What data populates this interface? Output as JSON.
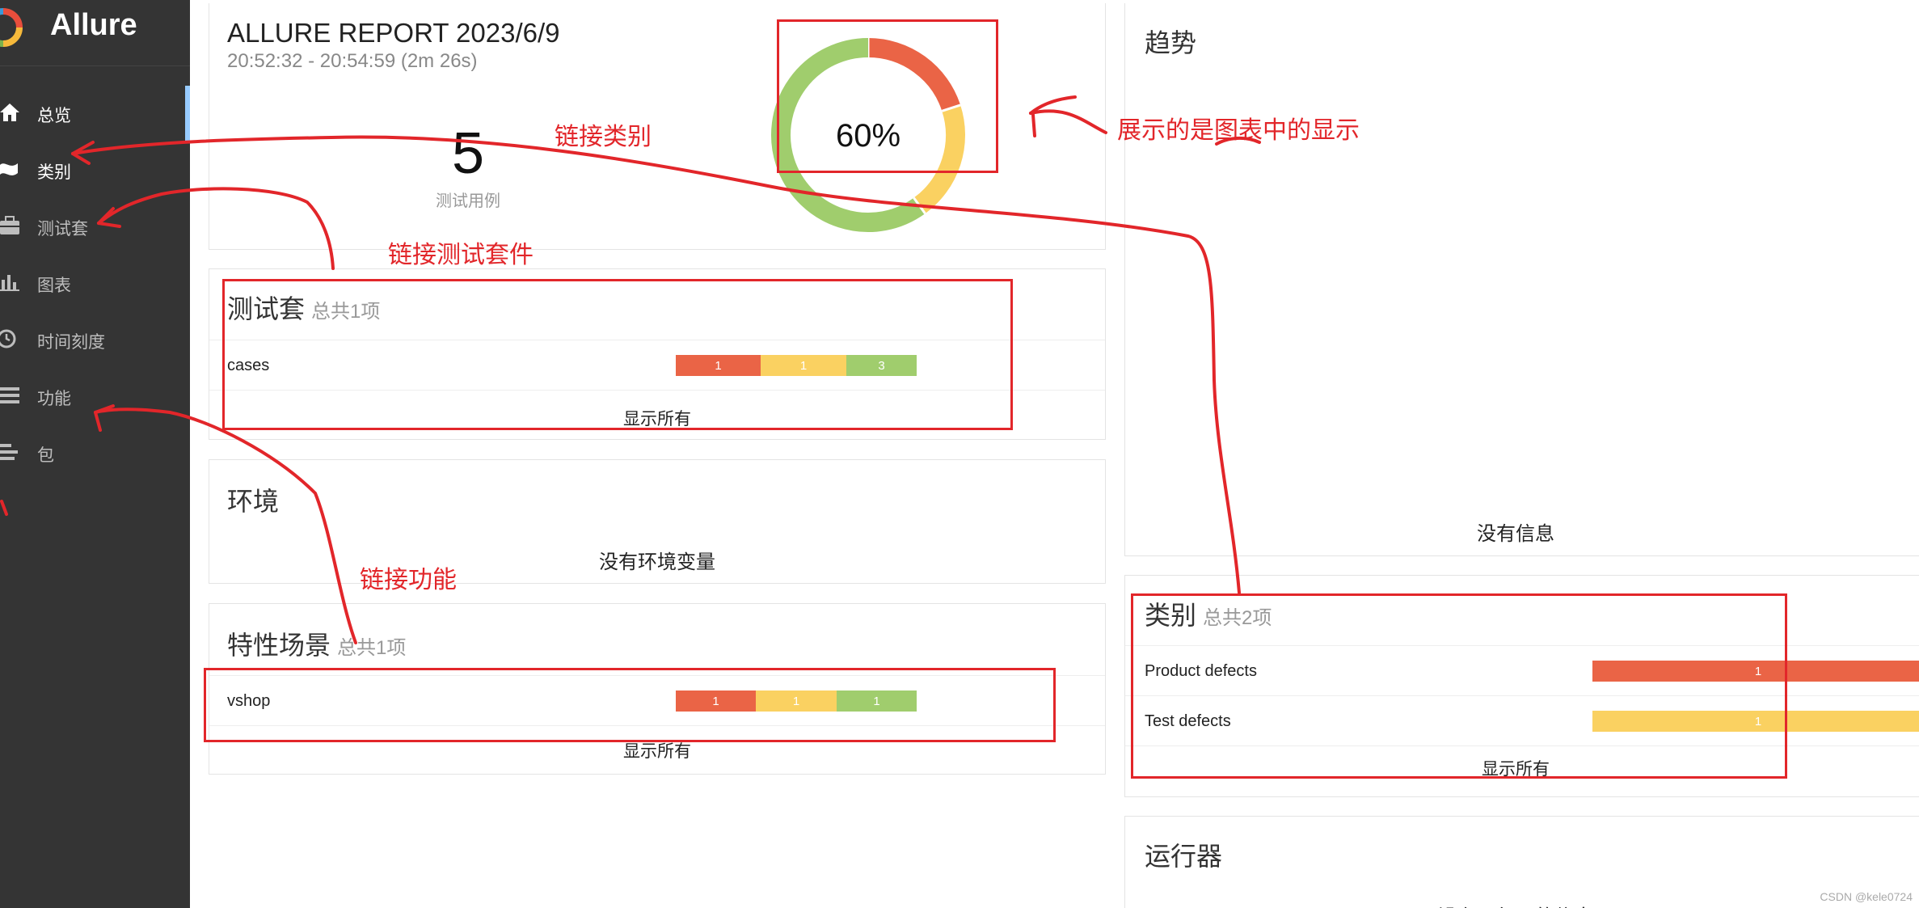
{
  "app": {
    "name": "Allure"
  },
  "sidebar": {
    "items": [
      {
        "label": "总览",
        "icon": "home-icon"
      },
      {
        "label": "类别",
        "icon": "flag-icon"
      },
      {
        "label": "测试套",
        "icon": "briefcase-icon"
      },
      {
        "label": "图表",
        "icon": "bar-chart-icon"
      },
      {
        "label": "时间刻度",
        "icon": "clock-icon"
      },
      {
        "label": "功能",
        "icon": "list-icon"
      },
      {
        "label": "包",
        "icon": "align-left-icon"
      }
    ]
  },
  "summary": {
    "title": "ALLURE REPORT 2023/6/9",
    "time": "20:52:32 - 20:54:59 (2m 26s)",
    "count": "5",
    "count_label": "测试用例",
    "percent": "60%",
    "pie": {
      "failed": 1,
      "broken": 1,
      "passed": 3
    }
  },
  "suites": {
    "title": "测试套",
    "count": "总共1项",
    "rows": [
      {
        "name": "cases",
        "failed": "1",
        "broken": "1",
        "passed": "3"
      }
    ],
    "show_all": "显示所有"
  },
  "environment": {
    "title": "环境",
    "empty": "没有环境变量"
  },
  "features": {
    "title": "特性场景",
    "count": "总共1项",
    "rows": [
      {
        "name": "vshop",
        "failed": "1",
        "broken": "1",
        "passed": "1"
      }
    ],
    "show_all": "显示所有"
  },
  "trend": {
    "title": "趋势",
    "empty": "没有信息"
  },
  "categories": {
    "title": "类别",
    "count": "总共2项",
    "rows": [
      {
        "name": "Product defects",
        "value": "1",
        "status": "failed"
      },
      {
        "name": "Test defects",
        "value": "1",
        "status": "broken"
      }
    ],
    "show_all": "显示所有"
  },
  "executors": {
    "title": "运行器",
    "empty": "没有运行器的信息"
  },
  "annotations": {
    "link_categories": "链接类别",
    "link_suites": "链接测试套件",
    "link_features": "链接功能",
    "chart_note": "展示的是图表中的显示"
  },
  "colors": {
    "failed": "#ea6446",
    "broken": "#fad161",
    "passed": "#a0cd6d",
    "sidebar": "#343434",
    "annotation": "#e2262a"
  },
  "watermark": "CSDN @kele0724"
}
